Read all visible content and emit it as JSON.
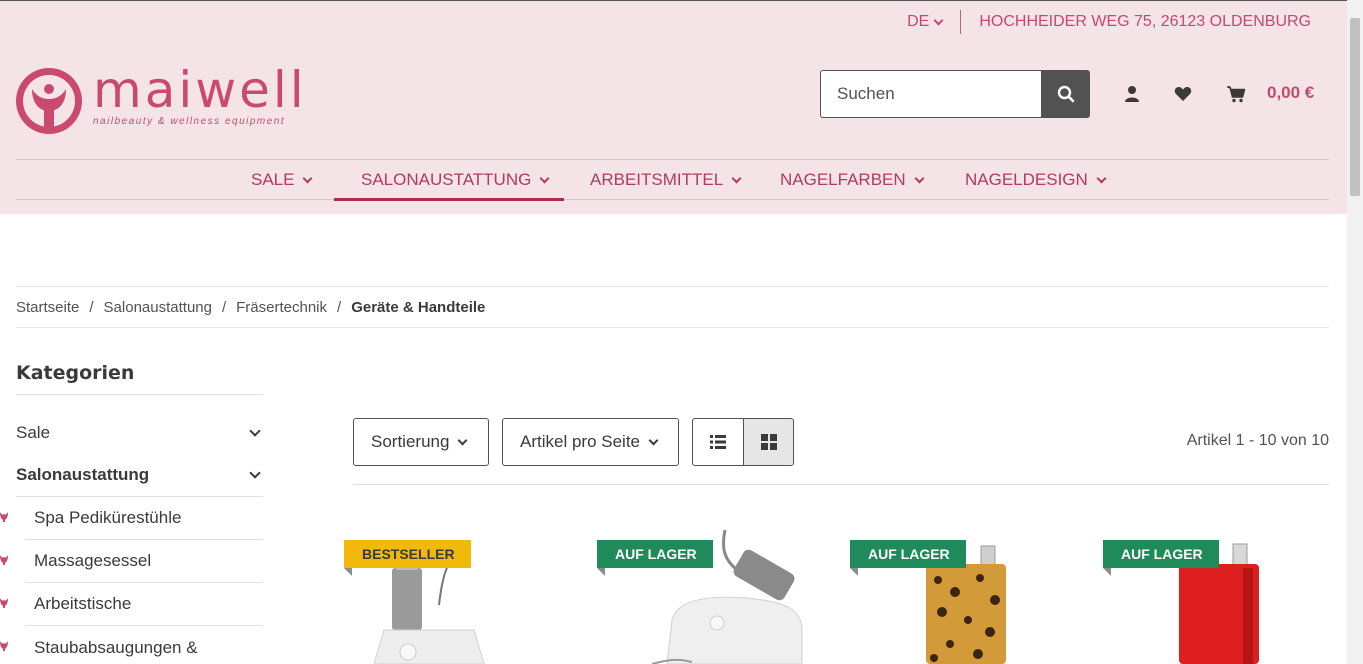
{
  "topbar": {
    "language": "DE",
    "address": "HOCHHEIDER WEG 75, 26123 OLDENBURG"
  },
  "logo": {
    "name": "maiwell",
    "tagline": "nailbeauty & wellness equipment"
  },
  "search": {
    "placeholder": "Suchen"
  },
  "cart": {
    "total": "0,00 €"
  },
  "nav": {
    "items": [
      {
        "label": "SALE"
      },
      {
        "label": "SALONAUSTATTUNG"
      },
      {
        "label": "ARBEITSMITTEL"
      },
      {
        "label": "NAGELFARBEN"
      },
      {
        "label": "NAGELDESIGN"
      }
    ]
  },
  "breadcrumb": {
    "items": [
      "Startseite",
      "Salonaustattung",
      "Fräsertechnik"
    ],
    "current": "Geräte & Handteile",
    "separator": "/"
  },
  "sidebar": {
    "title": "Kategorien",
    "categories": [
      {
        "label": "Sale"
      },
      {
        "label": "Salonaustattung"
      }
    ],
    "subcategories": [
      {
        "label": "Spa Pediküre­stühle"
      },
      {
        "label": "Massagesessel"
      },
      {
        "label": "Arbeitstische"
      },
      {
        "label": "Staubabsaugungen &"
      }
    ]
  },
  "toolbar": {
    "sort_label": "Sortierung",
    "per_page_label": "Artikel pro Seite",
    "count": "Artikel 1 - 10 von 10"
  },
  "products": [
    {
      "badge": "BESTSELLER"
    },
    {
      "badge": "AUF LAGER"
    },
    {
      "badge": "AUF LAGER"
    },
    {
      "badge": "AUF LAGER"
    }
  ],
  "colors": {
    "brand": "#c24a6e",
    "header_bg": "#f5e4e7",
    "stock": "#1f8a5a",
    "bestseller": "#f0b90b"
  }
}
